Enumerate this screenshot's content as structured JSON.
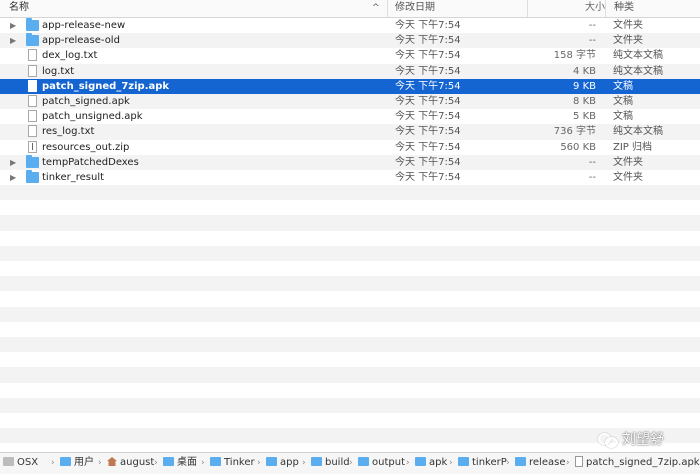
{
  "columns": {
    "name": "名称",
    "date": "修改日期",
    "size": "大小",
    "kind": "种类",
    "sort_indicator": "^"
  },
  "files": [
    {
      "name": "app-release-new",
      "date": "今天 下午7:54",
      "size": "--",
      "kind": "文件夹",
      "type": "folder"
    },
    {
      "name": "app-release-old",
      "date": "今天 下午7:54",
      "size": "--",
      "kind": "文件夹",
      "type": "folder"
    },
    {
      "name": "dex_log.txt",
      "date": "今天 下午7:54",
      "size": "158 字节",
      "kind": "纯文本文稿",
      "type": "doc"
    },
    {
      "name": "log.txt",
      "date": "今天 下午7:54",
      "size": "4 KB",
      "kind": "纯文本文稿",
      "type": "doc"
    },
    {
      "name": "patch_signed_7zip.apk",
      "date": "今天 下午7:54",
      "size": "9 KB",
      "kind": "文稿",
      "type": "doc",
      "selected": true
    },
    {
      "name": "patch_signed.apk",
      "date": "今天 下午7:54",
      "size": "8 KB",
      "kind": "文稿",
      "type": "doc"
    },
    {
      "name": "patch_unsigned.apk",
      "date": "今天 下午7:54",
      "size": "5 KB",
      "kind": "文稿",
      "type": "doc"
    },
    {
      "name": "res_log.txt",
      "date": "今天 下午7:54",
      "size": "736 字节",
      "kind": "纯文本文稿",
      "type": "doc"
    },
    {
      "name": "resources_out.zip",
      "date": "今天 下午7:54",
      "size": "560 KB",
      "kind": "ZIP 归档",
      "type": "zip"
    },
    {
      "name": "tempPatchedDexes",
      "date": "今天 下午7:54",
      "size": "--",
      "kind": "文件夹",
      "type": "folder"
    },
    {
      "name": "tinker_result",
      "date": "今天 下午7:54",
      "size": "--",
      "kind": "文件夹",
      "type": "folder"
    }
  ],
  "pathbar": [
    {
      "label": "OSX",
      "icon": "drive"
    },
    {
      "label": "用户",
      "icon": "folder"
    },
    {
      "label": "august",
      "icon": "home"
    },
    {
      "label": "桌面",
      "icon": "folder"
    },
    {
      "label": "Tinker",
      "icon": "folder"
    },
    {
      "label": "app",
      "icon": "folder"
    },
    {
      "label": "build",
      "icon": "folder"
    },
    {
      "label": "output",
      "icon": "folder"
    },
    {
      "label": "apk",
      "icon": "folder"
    },
    {
      "label": "tinkerP",
      "icon": "folder"
    },
    {
      "label": "release",
      "icon": "folder"
    },
    {
      "label": "patch_signed_7zip.apk",
      "icon": "doc"
    }
  ],
  "watermark": "刘望舒",
  "colors": {
    "selection": "#1464d2",
    "folder": "#5aaef0",
    "stripe": "#f3f3f3"
  }
}
